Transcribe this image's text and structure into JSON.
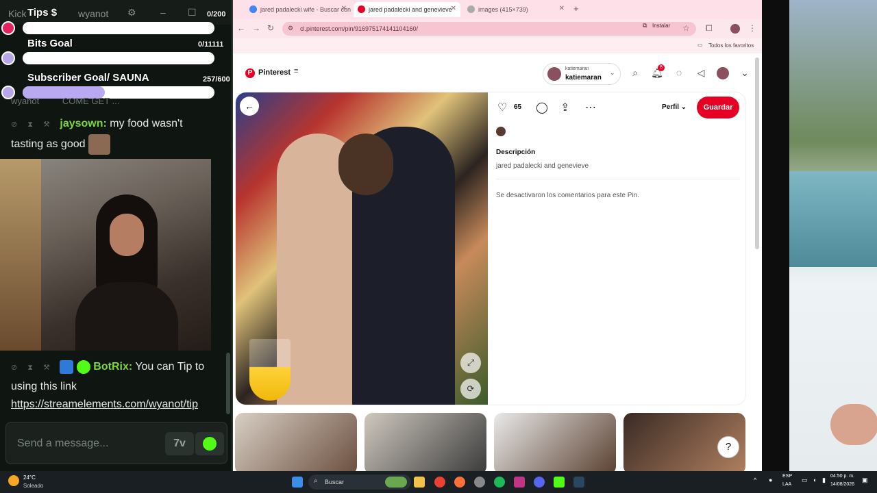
{
  "stream_overlay": {
    "kick_label": "Kick",
    "channel_name": "wyanot",
    "tips_goal": {
      "title": "Tips $",
      "count": "0/200",
      "progress": 0.0
    },
    "bits_goal": {
      "title": "Bits Goal",
      "count": "0/11111",
      "progress": 0.0
    },
    "sub_goal": {
      "title": "Subscriber Goal/ SAUNA",
      "count": "257/600",
      "progress": 0.43
    },
    "pinned_text": "COME GET ...",
    "chat": [
      {
        "user": "jaysown:",
        "message": "my food wasn't tasting as good"
      },
      {
        "user": "BotRix:",
        "message": "You can Tip to using this link",
        "link": "https://streamelements.com/wyanot/tip"
      }
    ],
    "input_placeholder": "Send a message...",
    "emote_button": "7v"
  },
  "browser": {
    "tabs": [
      {
        "label": "jared padalecki wife - Buscar con Google",
        "active": false
      },
      {
        "label": "jared padalecki and genevieve",
        "active": true
      },
      {
        "label": "images (415×739)",
        "active": false
      }
    ],
    "url": "cl.pinterest.com/pin/916975174141104160/",
    "install_label": "Instalar",
    "bookmarks_label": "Todos los favoritos"
  },
  "pinterest": {
    "brand": "Pinterest",
    "account_small": "katiemaran",
    "account_big": "katiemaran",
    "notification_count": "8",
    "likes": "65",
    "profile_label": "Perfil",
    "save_label": "Guardar",
    "description_title": "Descripción",
    "description_text": "jared padalecki and genevieve",
    "comments_off": "Se desactivaron los comentarios para este Pin.",
    "help_label": "?"
  },
  "taskbar": {
    "temperature": "24°C",
    "weather": "Soleado",
    "search_label": "Buscar",
    "lang_top": "ESP",
    "lang_bottom": "LAA",
    "time": "04:50 p. m.",
    "date": "14/08/2026"
  }
}
